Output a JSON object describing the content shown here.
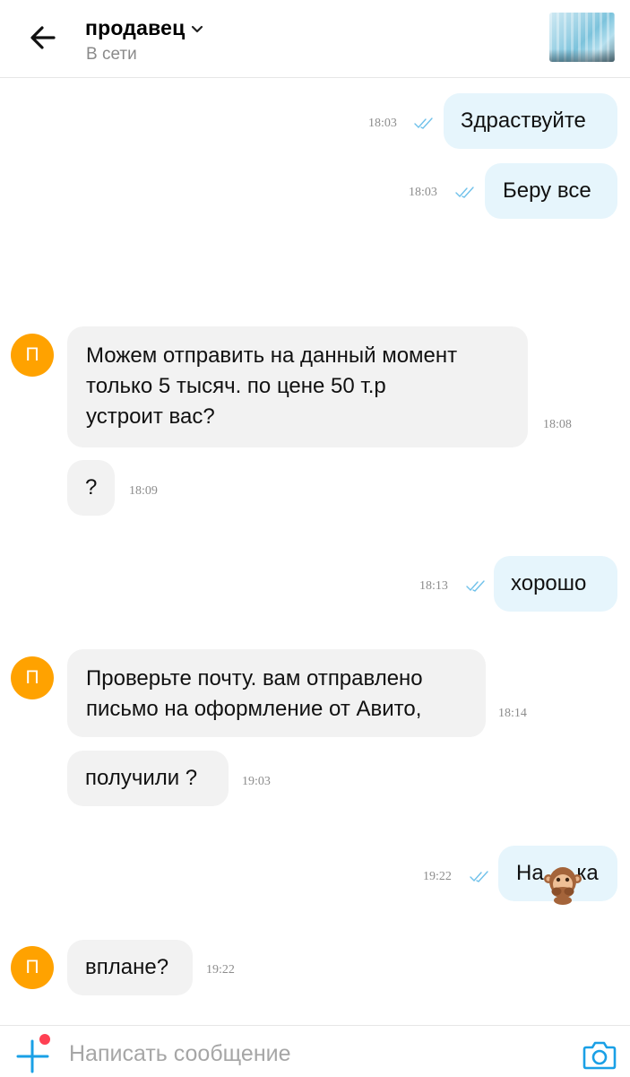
{
  "header": {
    "contact_name": "продавец",
    "status": "В сети"
  },
  "messages": [
    {
      "id": "m1",
      "direction": "outgoing",
      "text": "Здраствуйте",
      "time": "18:03",
      "read": true
    },
    {
      "id": "m2",
      "direction": "outgoing",
      "text": "Беру все",
      "time": "18:03",
      "read": true
    },
    {
      "id": "m3",
      "direction": "incoming",
      "avatar_letter": "П",
      "lines": [
        "Можем отправить на данный момент",
        "только 5 тысяч. по цене 50 т.р",
        "устроит вас?"
      ],
      "time": "18:08"
    },
    {
      "id": "m4",
      "direction": "incoming",
      "text": "?",
      "time": "18:09"
    },
    {
      "id": "m5",
      "direction": "outgoing",
      "text": "хорошо",
      "time": "18:13",
      "read": true
    },
    {
      "id": "m6",
      "direction": "incoming",
      "avatar_letter": "П",
      "lines": [
        "Проверьте почту. вам отправлено",
        "письмо на оформление от Авито,"
      ],
      "time": "18:14"
    },
    {
      "id": "m7",
      "direction": "incoming",
      "text": "получили ?",
      "time": "19:03"
    },
    {
      "id": "m8",
      "direction": "outgoing",
      "text": "На ка",
      "time": "19:22",
      "read": true,
      "overlay_emoji": "monkey-covering-mouth"
    },
    {
      "id": "m9",
      "direction": "incoming",
      "avatar_letter": "П",
      "text": "вплане?",
      "time": "19:22"
    }
  ],
  "composer": {
    "placeholder": "Написать сообщение"
  },
  "colors": {
    "outgoing_bubble": "#e6f5fc",
    "incoming_bubble": "#f2f2f2",
    "avatar": "#ffa200",
    "accent": "#00aaff",
    "notification_dot": "#ff4053"
  }
}
